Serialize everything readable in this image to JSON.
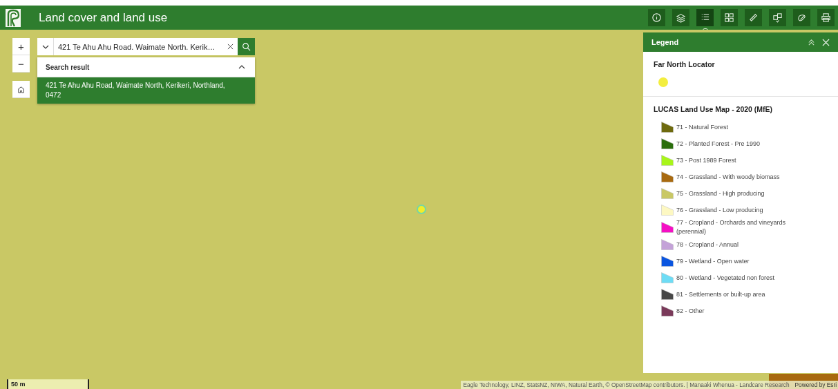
{
  "header": {
    "title": "Land cover and land use"
  },
  "toolbar": [
    {
      "kind": "info",
      "selected": false
    },
    {
      "kind": "layers",
      "selected": false
    },
    {
      "kind": "legend",
      "selected": true
    },
    {
      "kind": "grid",
      "selected": false
    },
    {
      "kind": "ruler",
      "selected": false
    },
    {
      "kind": "select",
      "selected": false
    },
    {
      "kind": "draw",
      "selected": false
    },
    {
      "kind": "print",
      "selected": false
    }
  ],
  "zoom": {
    "in": "+",
    "out": "−"
  },
  "search": {
    "value": "421 Te Ahu Ahu Road. Waimate North. Kerik…",
    "heading": "Search result",
    "results": [
      {
        "text": "421 Te Ahu Ahu Road, Waimate North, Kerikeri, Northland, 0472",
        "selected": true
      }
    ]
  },
  "legend": {
    "title": "Legend",
    "layers": [
      {
        "title": "Far North Locator",
        "items": [
          {
            "kind": "point",
            "color": "#f3ee3f"
          }
        ]
      },
      {
        "title": "LUCAS Land Use Map - 2020 (MfE)",
        "items": [
          {
            "kind": "polygon",
            "label": "71 - Natural Forest",
            "color": "#6e6a0e"
          },
          {
            "kind": "polygon",
            "label": "72 - Planted Forest - Pre 1990",
            "color": "#2a6e0c"
          },
          {
            "kind": "polygon",
            "label": "73 - Post 1989 Forest",
            "color": "#a8f51a"
          },
          {
            "kind": "polygon",
            "label": "74 - Grassland - With woody biomass",
            "color": "#a86a10"
          },
          {
            "kind": "polygon",
            "label": "75 - Grassland - High producing",
            "color": "#c9c865"
          },
          {
            "kind": "polygon",
            "label": "76 - Grassland - Low producing",
            "color": "#fdf8c2"
          },
          {
            "kind": "polygon",
            "label": "77 - Cropland - Orchards and vineyards (perennial)",
            "color": "#f50fc4"
          },
          {
            "kind": "polygon",
            "label": "78 - Cropland - Annual",
            "color": "#c4a2d8"
          },
          {
            "kind": "polygon",
            "label": "79 - Wetland - Open water",
            "color": "#0a55e0"
          },
          {
            "kind": "polygon",
            "label": "80 - Wetland - Vegetated non forest",
            "color": "#6edcf5"
          },
          {
            "kind": "polygon",
            "label": "81 - Settlements or built-up area",
            "color": "#474747"
          },
          {
            "kind": "polygon",
            "label": "82 - Other",
            "color": "#7a3a5a"
          }
        ]
      }
    ]
  },
  "scale_bar": {
    "label": "50 m"
  },
  "attribution": {
    "text": "Eagle Technology, LINZ, StatsNZ, NIWA, Natural Earth, © OpenStreetMap contributors. | Manaaki Whenua - Landcare Research",
    "powered": "Powered by Esri"
  }
}
